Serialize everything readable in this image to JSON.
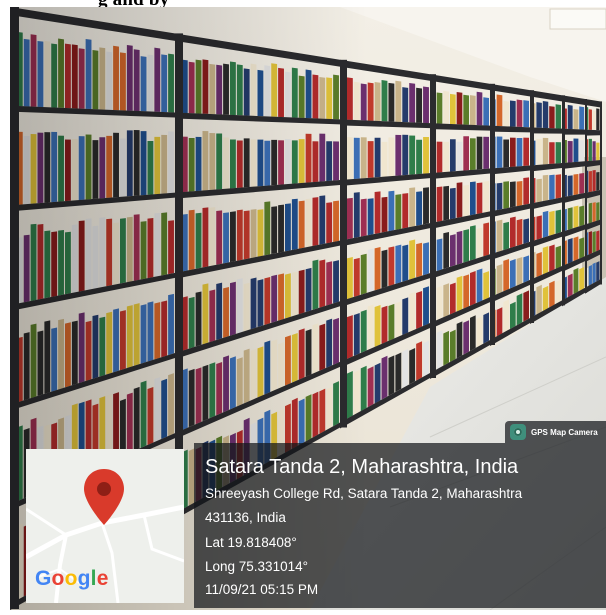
{
  "heading_fragment": "g  and  by",
  "camera_badge": {
    "label": "GPS Map Camera",
    "icon": "gps-camera-icon"
  },
  "map_thumbnail": {
    "pin_icon": "map-pin-icon",
    "pin_color": "#d93a2b",
    "logo_text": "Google"
  },
  "location": {
    "place": "Satara Tanda 2, Maharashtra, India",
    "address_line_1": "Shreeyash College Rd, Satara Tanda 2, Maharashtra",
    "address_line_2": "431136, India",
    "latitude": "Lat 19.818408°",
    "longitude": "Long 75.331014°",
    "timestamp": "11/09/21 05:15 PM"
  },
  "colors": {
    "overlay": "#14161a",
    "shelf_frame": "#2b2b2e",
    "wall": "#efe9dd",
    "floor": "#e7e6e2"
  }
}
